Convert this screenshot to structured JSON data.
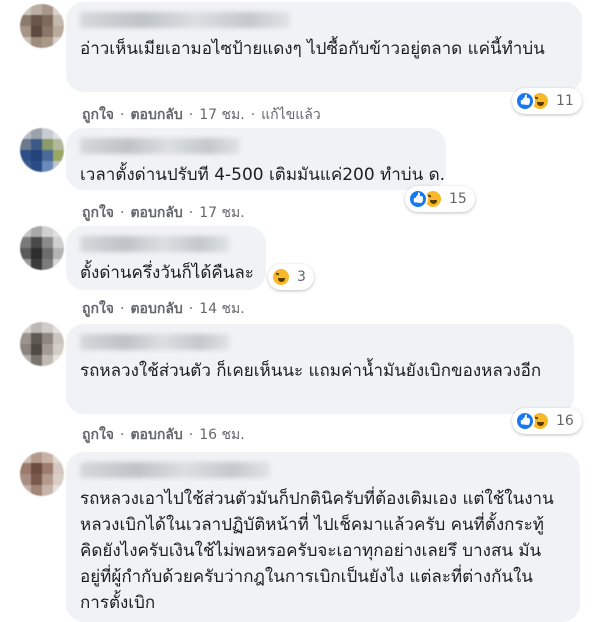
{
  "comments": [
    {
      "text": "อ่าวเห็นเมียเอามอไซป้ายแดงๆ ไปซื้อกับข้าวอยู่ตลาด แค่นี้ทำบ่น",
      "like": "ถูกใจ",
      "reply": "ตอบกลับ",
      "time": "17 ชม.",
      "edited": "แก้ไขแล้ว",
      "reactions": [
        "like",
        "haha"
      ],
      "reaction_count": "11"
    },
    {
      "text": "เวลาตั้งด่านปรับที 4-500 เติมมันแค่200 ทำบ่น ด.",
      "like": "ถูกใจ",
      "reply": "ตอบกลับ",
      "time": "17 ชม.",
      "reactions": [
        "like",
        "haha"
      ],
      "reaction_count": "15"
    },
    {
      "text": "ตั้งด่านครึ่งวันก็ได้คืนละ",
      "like": "ถูกใจ",
      "reply": "ตอบกลับ",
      "time": "14 ชม.",
      "reactions": [
        "haha"
      ],
      "reaction_count": "3"
    },
    {
      "text": "รถหลวงใช้ส่วนตัว ก็เคยเห็นนะ แถมค่าน้ำมันยังเบิกของหลวงอีก",
      "like": "ถูกใจ",
      "reply": "ตอบกลับ",
      "time": "16 ชม.",
      "reactions": [
        "like",
        "haha"
      ],
      "reaction_count": "16"
    },
    {
      "text": "รถหลวงเอาไปใช้ส่วนตัวมันก็ปกตินิครับที่ต้องเติมเอง แต่ใช้ในงานหลวงเบิกได้ในเวลาปฏิบัติหน้าที่ ไปเช็คมาแล้วครับ คนที่ตั้งกระทู้คิดยังไงครับเงินใช้ไม่พอหรอครับจะเอาทุกอย่างเลยรึ บางสน มันอยู่ที่ผู้กำกับด้วยครับว่ากฎในการเบิกเป็นยังไง แต่ละที่ต่างกันในการตั้งเบิก"
    }
  ],
  "colors": {
    "bubble": "#f0f2f5",
    "meta_text": "#65676b",
    "like_blue": "#1877f2",
    "haha_yellow": "#f7b928"
  }
}
